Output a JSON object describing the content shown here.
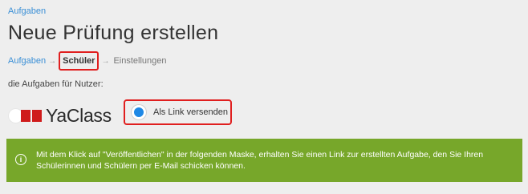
{
  "header": {
    "back_link": "Aufgaben",
    "title": "Neue Prüfung erstellen"
  },
  "breadcrumb": {
    "step1": "Aufgaben",
    "arrow": "→",
    "step2": "Schüler",
    "step3": "Einstellungen"
  },
  "form": {
    "subtext": "die Aufgaben für Nutzer:",
    "option_yaclass": "YaClass",
    "option_link": "Als Link versenden",
    "selected": "Als Link versenden"
  },
  "info": {
    "icon_glyph": "i",
    "text": "Mit dem Klick auf \"Veröffentlichen\" in der folgenden Maske, erhalten Sie einen Link zur erstellten Aufgabe, den Sie Ihren Schülerinnen und Schülern per E-Mail schicken können."
  },
  "colors": {
    "link": "#3a8fd6",
    "highlight": "#e01f1f",
    "info_bg": "#77a72a",
    "radio_selected": "#1e88e5",
    "brand_red": "#cf1b1b"
  }
}
